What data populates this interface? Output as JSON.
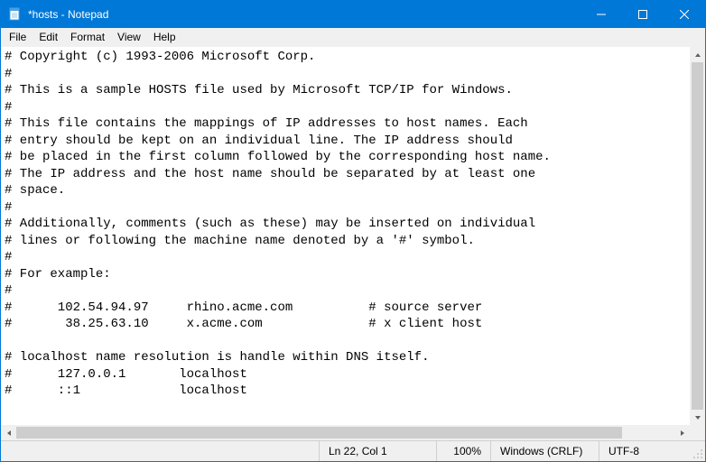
{
  "titlebar": {
    "title": "*hosts - Notepad"
  },
  "menu": {
    "file": "File",
    "edit": "Edit",
    "format": "Format",
    "view": "View",
    "help": "Help"
  },
  "editor": {
    "content": "# Copyright (c) 1993-2006 Microsoft Corp.\n#\n# This is a sample HOSTS file used by Microsoft TCP/IP for Windows.\n#\n# This file contains the mappings of IP addresses to host names. Each\n# entry should be kept on an individual line. The IP address should\n# be placed in the first column followed by the corresponding host name.\n# The IP address and the host name should be separated by at least one\n# space.\n#\n# Additionally, comments (such as these) may be inserted on individual\n# lines or following the machine name denoted by a '#' symbol.\n#\n# For example:\n#\n#      102.54.94.97     rhino.acme.com          # source server\n#       38.25.63.10     x.acme.com              # x client host\n\n# localhost name resolution is handle within DNS itself.\n#      127.0.0.1       localhost\n#      ::1             localhost\n"
  },
  "status": {
    "position": "Ln 22, Col 1",
    "zoom": "100%",
    "eol": "Windows (CRLF)",
    "encoding": "UTF-8"
  }
}
